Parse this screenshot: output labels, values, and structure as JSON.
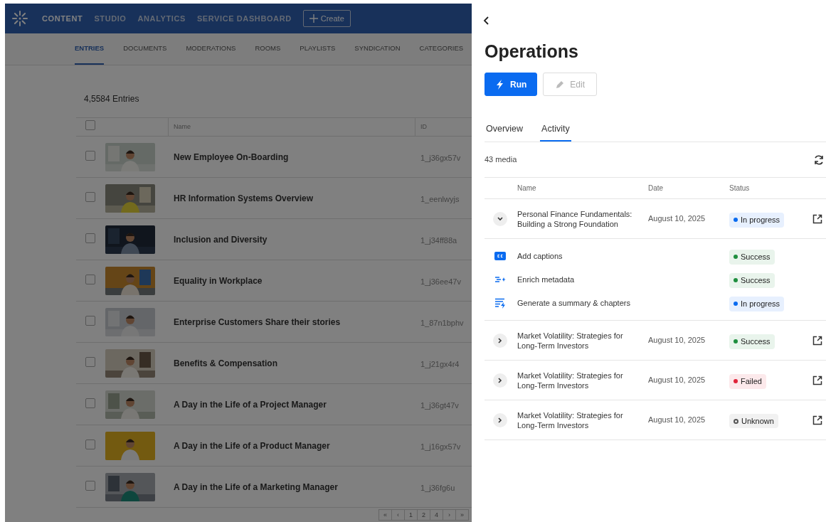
{
  "top_nav": {
    "items": [
      {
        "label": "CONTENT",
        "selected": true
      },
      {
        "label": "STUDIO",
        "selected": false
      },
      {
        "label": "ANALYTICS",
        "selected": false
      },
      {
        "label": "SERVICE DASHBOARD",
        "selected": false
      }
    ],
    "create_button": "Create"
  },
  "sub_tabs": [
    {
      "label": "ENTRIES",
      "selected": true
    },
    {
      "label": "DOCUMENTS",
      "selected": false
    },
    {
      "label": "MODERATIONS",
      "selected": false
    },
    {
      "label": "ROOMS",
      "selected": false
    },
    {
      "label": "PLAYLISTS",
      "selected": false
    },
    {
      "label": "SYNDICATION",
      "selected": false
    },
    {
      "label": "CATEGORIES",
      "selected": false
    }
  ],
  "entries": {
    "count": "4,5584 Entries",
    "header_checked": false,
    "columns": [
      "Name",
      "ID"
    ],
    "rows": [
      {
        "name": "New Employee On-Boarding",
        "id": "1_j36gx57v",
        "checked": false
      },
      {
        "name": "HR Information Systems Overview",
        "id": "1_eenlwyjs",
        "checked": false
      },
      {
        "name": "Inclusion and Diversity",
        "id": "1_j34ff88a",
        "checked": false
      },
      {
        "name": "Equality in Workplace",
        "id": "1_j36ee47v",
        "checked": false
      },
      {
        "name": "Enterprise Customers Share their stories",
        "id": "1_87n1bphv",
        "checked": false
      },
      {
        "name": "Benefits & Compensation",
        "id": "1_j21gx4r4",
        "checked": false
      },
      {
        "name": "A Day in the Life of a Project Manager",
        "id": "1_j36gt47v",
        "checked": false
      },
      {
        "name": "A Day in the Life of a Product Manager",
        "id": "1_j16gx57v",
        "checked": false
      },
      {
        "name": "A Day in the Life of a Marketing Manager",
        "id": "1_j36fg6u",
        "checked": false
      }
    ]
  },
  "pagination": [
    {
      "label": "«"
    },
    {
      "label": "‹"
    },
    {
      "label": "1"
    },
    {
      "label": "2"
    },
    {
      "label": "4"
    },
    {
      "label": "›"
    },
    {
      "label": "»"
    }
  ],
  "panel": {
    "title": "Operations",
    "buttons": [
      {
        "label": "Run",
        "kind": "run",
        "disabled": false
      },
      {
        "label": "Edit",
        "kind": "edit",
        "disabled": true
      }
    ],
    "tabs": [
      {
        "label": "Overview",
        "selected": false
      },
      {
        "label": "Activity",
        "selected": true
      }
    ],
    "count": "43 media",
    "columns": [
      "Name",
      "Date",
      "Status"
    ],
    "rows": [
      {
        "name": "Personal Finance Fundamentals: Building a Strong Foundation",
        "date": "August 10, 2025",
        "status": {
          "label": "In progress",
          "color": "#0a6bf0",
          "filled": true
        },
        "expanded": true,
        "children": [
          {
            "kind": "captions",
            "name": "Add captions",
            "status": {
              "label": "Success",
              "color": "#1e8e3e",
              "filled": true
            }
          },
          {
            "kind": "enrich",
            "name": "Enrich metadata",
            "status": {
              "label": "Success",
              "color": "#1e8e3e",
              "filled": true
            }
          },
          {
            "kind": "summary",
            "name": "Generate a summary & chapters",
            "status": {
              "label": "In progress",
              "color": "#0a6bf0",
              "filled": true
            }
          }
        ]
      },
      {
        "name": "Market Volatility: Strategies for Long-Term Investors",
        "date": "August 10, 2025",
        "status": {
          "label": "Success",
          "color": "#1e8e3e",
          "filled": true
        },
        "expanded": false
      },
      {
        "name": "Market Volatility: Strategies for Long-Term Investors",
        "date": "August 10, 2025",
        "status": {
          "label": "Failed",
          "color": "#e0243a",
          "filled": true
        },
        "expanded": false
      },
      {
        "name": "Market Volatility: Strategies for Long-Term Investors",
        "date": "August 10, 2025",
        "status": {
          "label": "Unknown",
          "color": "#555555",
          "filled": false
        },
        "expanded": false
      }
    ]
  }
}
